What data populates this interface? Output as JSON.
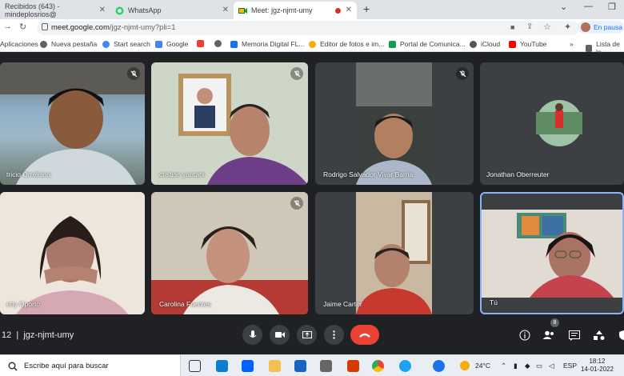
{
  "browser": {
    "tabs": [
      {
        "title": "Recibidos (643) - mindeplosrios@"
      },
      {
        "title": "WhatsApp"
      },
      {
        "title": "Meet: jgz-njmt-umy"
      }
    ],
    "url_host": "meet.google.com",
    "url_path": "/jgz-njmt-umy?pli=1",
    "profile_label": "En pausa",
    "bookmarks": [
      "Aplicaciones",
      "Nueva pestaña",
      "Start search",
      "Google",
      "M",
      "Memoria Digital FL...",
      "Editor de fotos e im...",
      "Portal de Comunica...",
      "iCloud",
      "YouTube"
    ],
    "reading_list": "Lista de le"
  },
  "meet": {
    "participants": [
      {
        "name": "Patricio Orrellana",
        "shown": "tricio Orrellana",
        "muted": true
      },
      {
        "name": "cristian yantani",
        "muted": true
      },
      {
        "name": "Rodrigo Salvador Vivar Barria",
        "muted": true
      },
      {
        "name": "Jonathan Oberreuter",
        "muted": false
      },
      {
        "name": "Betty Oporto",
        "shown": "etty Oporto",
        "muted": false
      },
      {
        "name": "Carolina Fuentes",
        "muted": true
      },
      {
        "name": "Jaime Carter",
        "muted": false
      },
      {
        "name": "Tú",
        "muted": false
      }
    ],
    "time_prefix": "12",
    "meeting_code": "jgz-njmt-umy",
    "people_count": "8",
    "colors": {
      "hangup": "#ea4335",
      "bg": "#202124",
      "self_border": "#8ab4f8"
    }
  },
  "taskbar": {
    "search_placeholder": "Escribe aquí para buscar",
    "temperature": "24°C",
    "lang": "ESP",
    "time": "18:12",
    "date": "14-01-2022"
  }
}
